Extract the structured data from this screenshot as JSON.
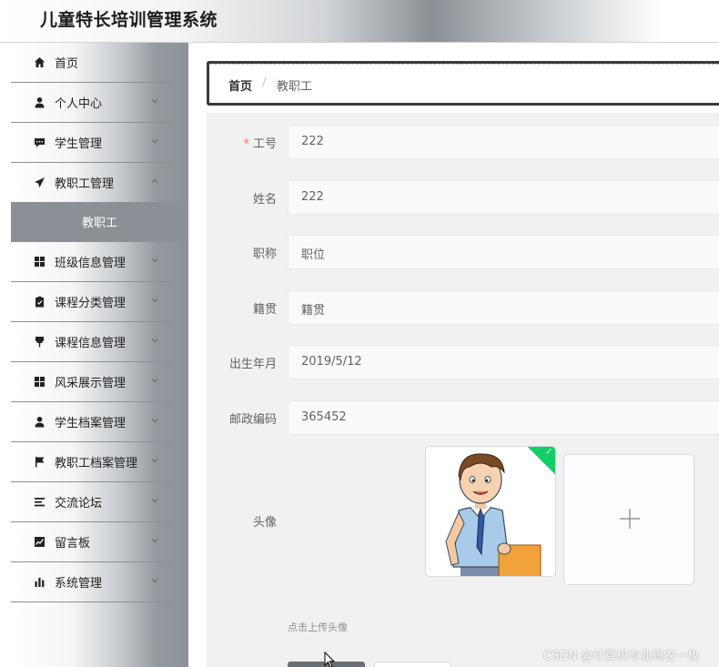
{
  "app": {
    "title": "儿童特长培训管理系统"
  },
  "sidebar": {
    "items": [
      {
        "label": "首页",
        "icon": "home-icon"
      },
      {
        "label": "个人中心",
        "icon": "user-icon"
      },
      {
        "label": "学生管理",
        "icon": "chat-icon"
      },
      {
        "label": "教职工管理",
        "icon": "send-icon"
      },
      {
        "label": "班级信息管理",
        "icon": "grid-icon"
      },
      {
        "label": "课程分类管理",
        "icon": "clipboard-icon"
      },
      {
        "label": "课程信息管理",
        "icon": "pin-icon"
      },
      {
        "label": "风采展示管理",
        "icon": "grid-icon"
      },
      {
        "label": "学生档案管理",
        "icon": "user-icon"
      },
      {
        "label": "教职工档案管理",
        "icon": "flag-icon"
      },
      {
        "label": "交流论坛",
        "icon": "list-icon"
      },
      {
        "label": "留言板",
        "icon": "chart-line-icon"
      },
      {
        "label": "系统管理",
        "icon": "bar-chart-icon"
      }
    ],
    "submenu": {
      "label": "教职工"
    }
  },
  "breadcrumb": {
    "home": "首页",
    "separator": "/",
    "current": "教职工"
  },
  "form": {
    "fields": [
      {
        "label": "工号",
        "required": "*",
        "value": "222"
      },
      {
        "label": "姓名",
        "value": "222"
      },
      {
        "label": "职称",
        "value": "职位"
      },
      {
        "label": "籍贯",
        "value": "籍贯"
      },
      {
        "label": "出生年月",
        "value": "2019/5/12"
      },
      {
        "label": "邮政编码",
        "value": "365452"
      }
    ],
    "avatar": {
      "label": "头像",
      "tip": "点击上传头像"
    }
  },
  "watermark": "CSDN @计算机专业码农一枚",
  "colors": {
    "sidebar_active": "#8a9096",
    "required": "#f56c6c",
    "success": "#13ce66"
  }
}
